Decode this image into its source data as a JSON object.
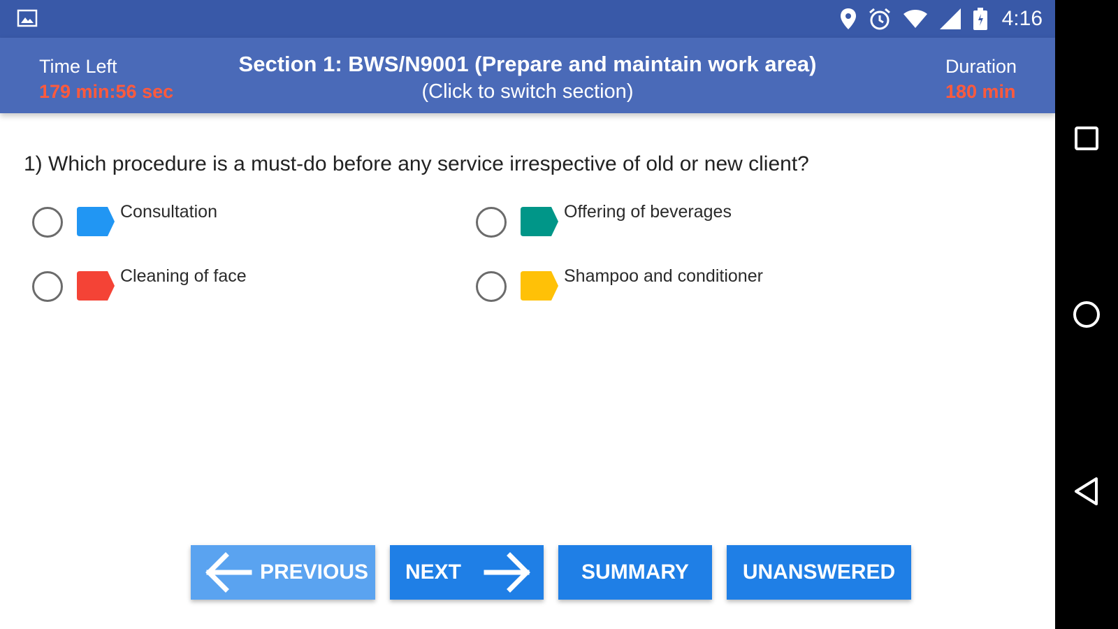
{
  "status_bar": {
    "time": "4:16",
    "icons": [
      "gallery-icon",
      "location-icon",
      "alarm-icon",
      "wifi-icon",
      "signal-icon",
      "battery-icon"
    ]
  },
  "header": {
    "time_left_label": "Time Left",
    "time_left_value": "179 min:56 sec",
    "section_title": "Section 1:  BWS/N9001 (Prepare and maintain work area)",
    "section_subtitle": "(Click to switch section)",
    "duration_label": "Duration",
    "duration_value": "180 min"
  },
  "question": {
    "text": "1) Which procedure is a must-do before any service irrespective of old or new client?",
    "options": [
      {
        "label": "Consultation",
        "color": "#2196f3"
      },
      {
        "label": "Offering of beverages",
        "color": "#009688"
      },
      {
        "label": "Cleaning of face",
        "color": "#f44336"
      },
      {
        "label": "Shampoo and conditioner",
        "color": "#ffc107"
      }
    ]
  },
  "buttons": {
    "previous": "PREVIOUS",
    "next": "NEXT",
    "summary": "SUMMARY",
    "unanswered": "UNANSWERED"
  },
  "nav_bar": {
    "icons": [
      "recents-icon",
      "home-icon",
      "back-icon"
    ]
  },
  "colors": {
    "status_bar": "#3959a8",
    "header": "#4a6ab8",
    "timer_text": "#ff5a3c",
    "button_primary": "#1f7fe6",
    "button_disabled": "#5aa3f0"
  }
}
